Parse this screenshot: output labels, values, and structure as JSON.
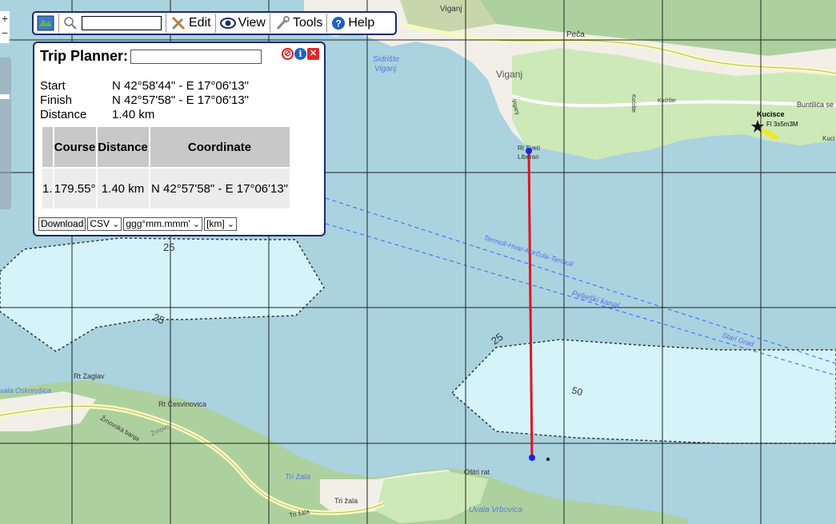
{
  "toolbar": {
    "edit_label": "Edit",
    "view_label": "View",
    "tools_label": "Tools",
    "help_label": "Help",
    "search_value": ""
  },
  "zoom": {
    "in_label": "+",
    "out_label": "−"
  },
  "trip_planner": {
    "title": "Trip Planner:",
    "name_value": "",
    "start_label": "Start",
    "start_value": "N 42°58'44\" - E 17°06'13\"",
    "finish_label": "Finish",
    "finish_value": "N 42°57'58\" - E 17°06'13\"",
    "distance_label": "Distance",
    "distance_value": "1.40 km",
    "table": {
      "headers": [
        "",
        "Course",
        "Distance",
        "Coordinate"
      ],
      "rows": [
        [
          "1.",
          "179.55°",
          "1.40 km",
          "N 42°57'58\" - E 17°06'13\""
        ]
      ]
    },
    "download_label": "Download",
    "format_selected": "CSV",
    "coord_format_selected": "ggg°mm.mmm'",
    "unit_selected": "[km]"
  },
  "map_labels": {
    "viganj_top": "Viganj",
    "peca": "Peča",
    "sidriste": "Sidrište",
    "viganj_italic": "Viganj",
    "viganj_town": "Viganj",
    "viganj_road": "Viganj",
    "kuciste_road": "Kućište",
    "kuciste": "Kućište",
    "buntilica": "Buntilića se",
    "kucisce": "Kucisce",
    "light": "Fl 3s5m3M",
    "kuci_edge": "Kuci",
    "rt_sveti": "Rt Sveti",
    "liberan": "Liberan",
    "ferry1": "Termoli-Hvar-Korčula-Termoli",
    "peljeski": "Pelješki kanal",
    "stari_grad": "Stari Grad",
    "depth_25_a": "25",
    "depth_25_b": "25",
    "depth_25_c": "25",
    "depth_50": "50",
    "rt_zaglav": "Rt Zaglav",
    "uvala_oskorusica": "vala Oskorušica",
    "rt_cesvinovica": "Rt Česvinovica",
    "zrnovska_banja": "Žrnovska banja",
    "zrnovo": "Žrnovo",
    "tri_zala_sea": "Tri žala",
    "tri_zala_1": "Tri žala",
    "tri_zala_2": "Tri žala",
    "ostri_rat": "Oštri rat",
    "uvala_vrbovica": "Uvala Vrbovica"
  }
}
